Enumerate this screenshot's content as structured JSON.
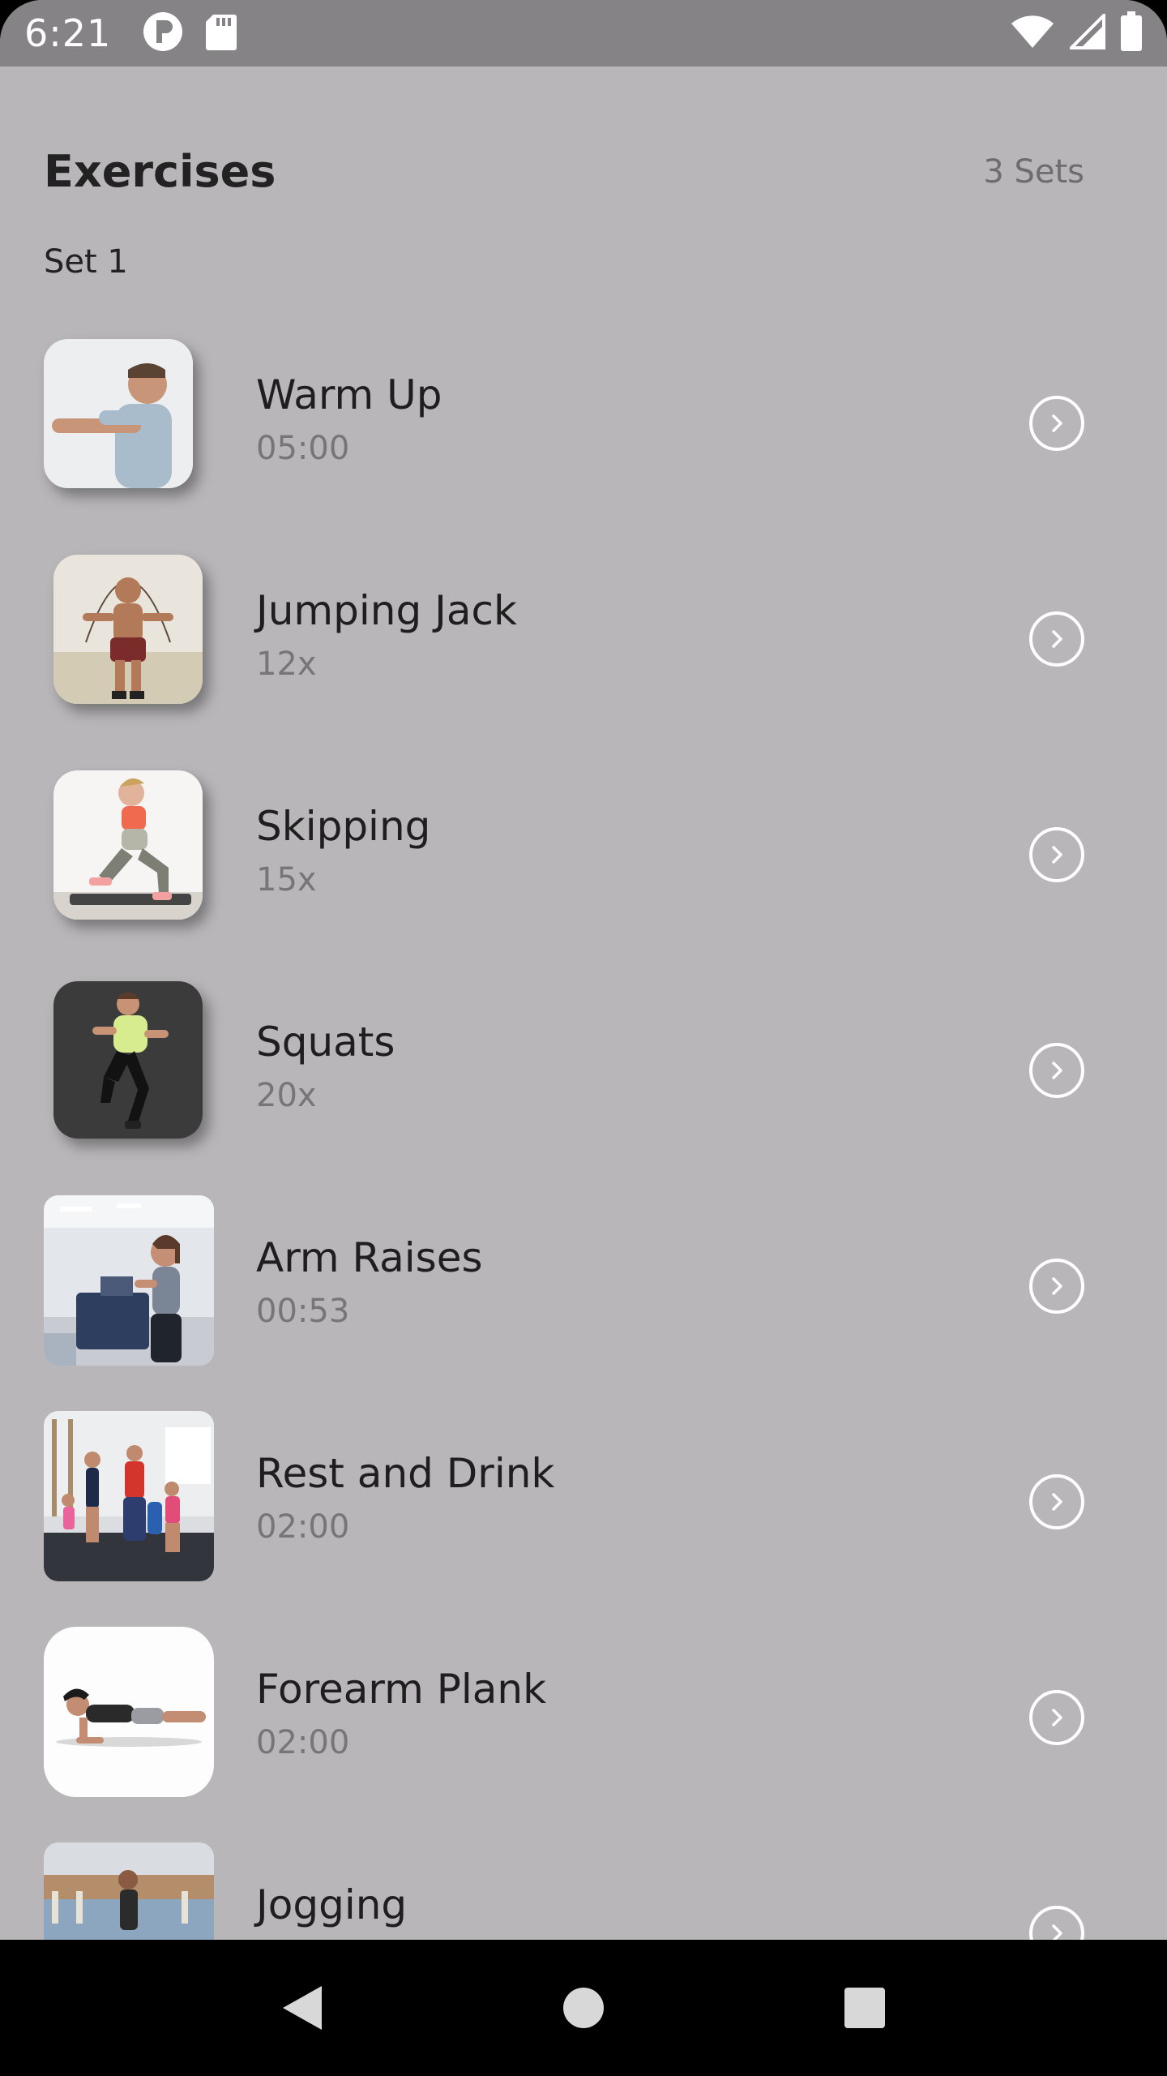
{
  "status_bar": {
    "time": "6:21",
    "left_icons": [
      "p-icon",
      "sd-card-icon"
    ],
    "right_icons": [
      "wifi-icon",
      "signal-icon",
      "battery-icon"
    ]
  },
  "header": {
    "title": "Exercises",
    "sets_count": "3 Sets"
  },
  "set_label": "Set 1",
  "exercises": [
    {
      "name": "Warm Up",
      "meta": "05:00",
      "image": "man-stretching-arm"
    },
    {
      "name": "Jumping Jack",
      "meta": "12x",
      "image": "man-jump-rope"
    },
    {
      "name": "Skipping",
      "meta": "15x",
      "image": "woman-lunge"
    },
    {
      "name": "Squats",
      "meta": "20x",
      "image": "man-running-in-place"
    },
    {
      "name": "Arm Raises",
      "meta": "00:53",
      "image": "woman-on-treadmill"
    },
    {
      "name": "Rest and Drink",
      "meta": "02:00",
      "image": "group-gym-class"
    },
    {
      "name": "Forearm Plank",
      "meta": "02:00",
      "image": "woman-planking"
    },
    {
      "name": "Jogging",
      "meta": "",
      "image": "man-jogging-stadium"
    }
  ],
  "nav": {
    "icons": [
      "back-icon",
      "home-icon",
      "recents-icon"
    ]
  }
}
